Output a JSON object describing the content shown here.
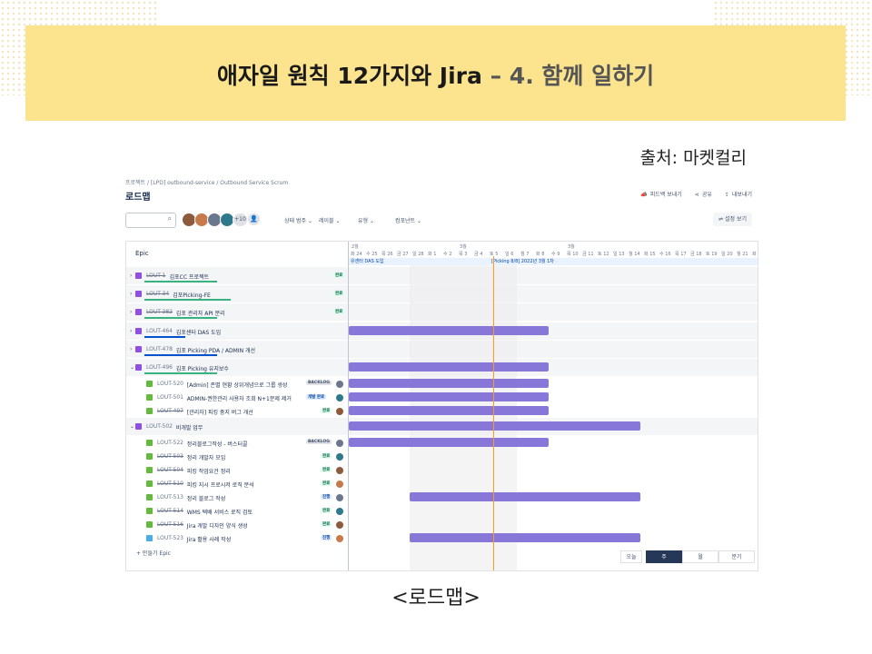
{
  "slide": {
    "title_main": "애자일 원칙 12가지와 Jira",
    "title_dash": " – ",
    "title_sub": "4. 함께 일하기",
    "source": "출처: 마켓컬리",
    "caption": "<로드맵>"
  },
  "jira": {
    "breadcrumb": "프로젝트  /  [LPD] outbound-service  /  Outbound Service Scrum",
    "page_title": "로드맵",
    "actions": {
      "feedback": "피드백 보내기",
      "share": "공유",
      "export": "내보내기"
    },
    "filters": {
      "avatar_more": "+10",
      "status": "상태 범주",
      "label": "레이블",
      "type": "유형",
      "component": "컴포넌트"
    },
    "view_settings": "설정 보기",
    "epic_header": "Epic",
    "timeline": {
      "months": [
        "2월",
        "3월",
        "3월"
      ],
      "days": [
        "화 24",
        "수 25",
        "목 26",
        "금 27",
        "일 28",
        "화 1",
        "수 2",
        "목 3",
        "금 4",
        "토 5",
        "일 6",
        "월 7",
        "화 8",
        "수 9",
        "목 10",
        "금 11",
        "토 12",
        "일 13",
        "월 14",
        "화 15",
        "수 16",
        "목 17",
        "금 18",
        "토 19",
        "일 20",
        "월 21",
        "화 22"
      ],
      "sprint_left": "유센터 DAS 도입",
      "sprint_right": "[Picking 8/8] 2022년 3월 1차"
    },
    "rows": [
      {
        "key": "LOUT-1",
        "summary": "김포CC 프로젝트",
        "status": "완료",
        "done": true
      },
      {
        "key": "LOUT-34",
        "summary": "김포Picking-FE",
        "status": "완료",
        "done": true
      },
      {
        "key": "LOUT-382",
        "summary": "김포 관리자 API 분리",
        "status": "완료",
        "done": true
      },
      {
        "key": "LOUT-464",
        "summary": "김포센터 DAS 도입",
        "status": "",
        "done": false
      },
      {
        "key": "LOUT-478",
        "summary": "김포 Picking PDA / ADMIN 개선",
        "status": "",
        "done": false
      },
      {
        "key": "LOUT-496",
        "summary": "김포 Picking 유지보수",
        "status": "",
        "done": false
      },
      {
        "key": "LOUT-520",
        "summary": "[Admin] 존별 현황 상위개념으로 그룹 생성",
        "status": "BACKLOG",
        "done": false
      },
      {
        "key": "LOUT-501",
        "summary": "ADMIN-권한관리 사용자 조회 N+1문제 제거",
        "status": "개발 완료",
        "done": false
      },
      {
        "key": "LOUT-497",
        "summary": "[관리자] 피킹 중지 버그 개선",
        "status": "완료",
        "done": true
      },
      {
        "key": "LOUT-502",
        "summary": "비개발 업무",
        "status": "",
        "done": false
      },
      {
        "key": "LOUT-522",
        "summary": "정리블로그작성 - 버스터콜",
        "status": "BACKLOG",
        "done": false
      },
      {
        "key": "LOUT-503",
        "summary": "정리 개발자 모임",
        "status": "완료",
        "done": true
      },
      {
        "key": "LOUT-504",
        "summary": "피킹 작업요건 정리",
        "status": "완료",
        "done": true
      },
      {
        "key": "LOUT-510",
        "summary": "피킹 지시 프로시저 로직 분석",
        "status": "완료",
        "done": true
      },
      {
        "key": "LOUT-513",
        "summary": "정리 블로그 작성",
        "status": "진행",
        "done": false
      },
      {
        "key": "LOUT-514",
        "summary": "WMS 택배 서비스 로직 검토",
        "status": "완료",
        "done": true
      },
      {
        "key": "LOUT-516",
        "summary": "Jira 개발 디자인 양식 생성",
        "status": "완료",
        "done": true
      },
      {
        "key": "LOUT-523",
        "summary": "Jira 활용 사례 작성",
        "status": "진행",
        "done": false
      }
    ],
    "create_epic": "+ 만들기 Epic",
    "zoom": {
      "today": "오늘",
      "week": "주",
      "month": "월",
      "quarter": "분기"
    },
    "colors": {
      "epic": "#904ee2",
      "story": "#63ba3c",
      "task": "#4bade8",
      "bar": "#8777d9",
      "today_line": "#ff991f"
    }
  }
}
